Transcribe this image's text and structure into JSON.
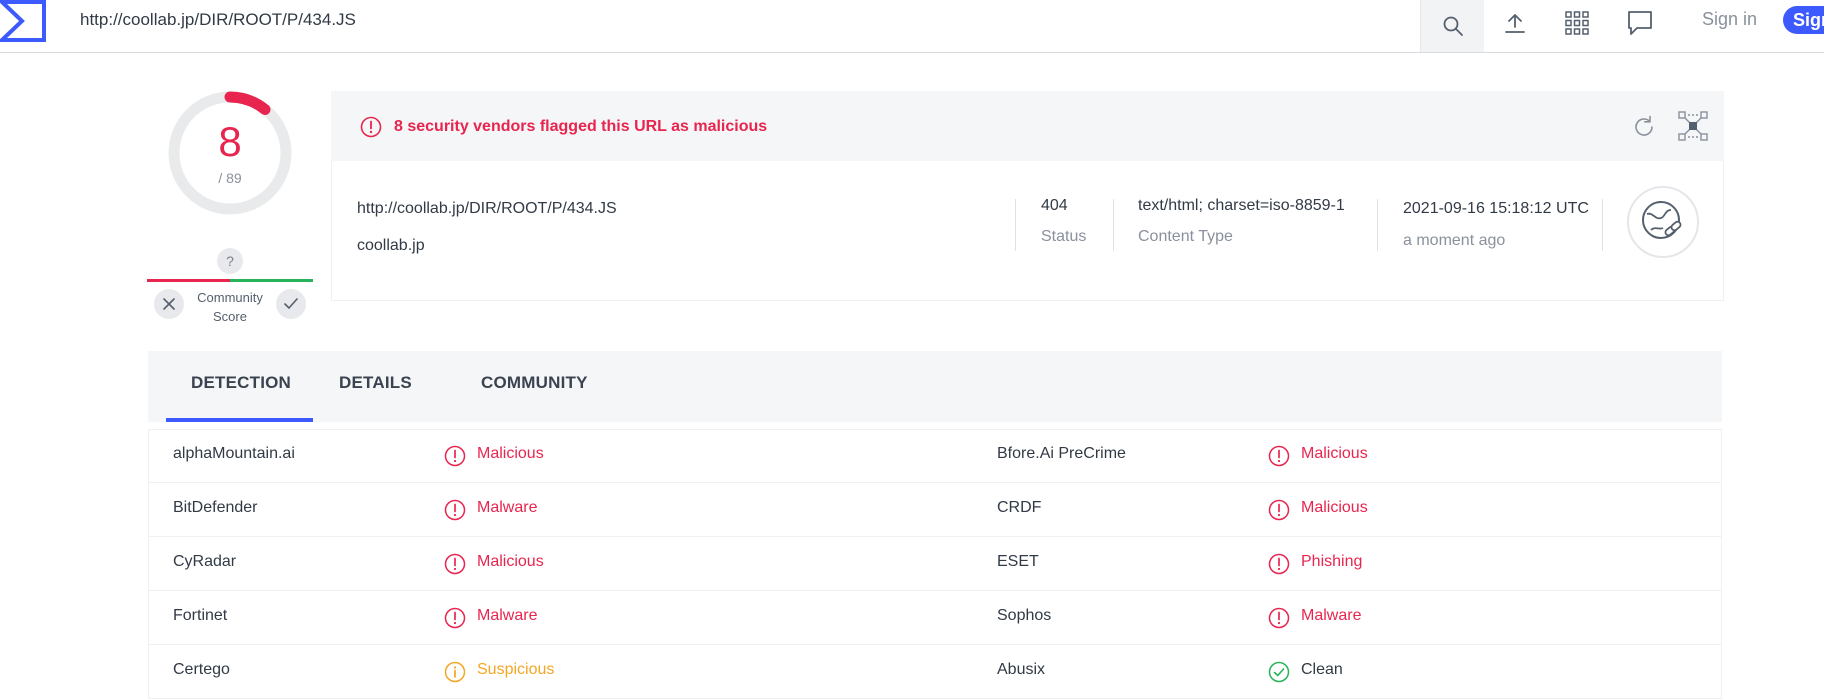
{
  "topbar": {
    "url": "http://coollab.jp/DIR/ROOT/P/434.JS",
    "signin_label": "Sign in",
    "signup_label": "Sign",
    "icons": [
      "search-icon",
      "upload-icon",
      "apps-grid-icon",
      "chat-icon"
    ]
  },
  "score": {
    "detections": "8",
    "total": "/ 89",
    "community_unknown": "?",
    "community_label_1": "Community",
    "community_label_2": "Score"
  },
  "summary": {
    "alert": "8 security vendors flagged this URL as malicious",
    "url": "http://coollab.jp/DIR/ROOT/P/434.JS",
    "domain": "coollab.jp",
    "status_value": "404",
    "status_label": "Status",
    "content_type_value": "text/html; charset=iso-8859-1",
    "content_type_label": "Content Type",
    "date_value": "2021-09-16 15:18:12 UTC",
    "date_label": "a moment ago"
  },
  "tabs": [
    "DETECTION",
    "DETAILS",
    "COMMUNITY"
  ],
  "detections": [
    {
      "vendor": "alphaMountain.ai",
      "verdict": "Malicious",
      "kind": "malicious",
      "vendor2": "Bfore.Ai PreCrime",
      "verdict2": "Malicious",
      "kind2": "malicious"
    },
    {
      "vendor": "BitDefender",
      "verdict": "Malware",
      "kind": "malicious",
      "vendor2": "CRDF",
      "verdict2": "Malicious",
      "kind2": "malicious"
    },
    {
      "vendor": "CyRadar",
      "verdict": "Malicious",
      "kind": "malicious",
      "vendor2": "ESET",
      "verdict2": "Phishing",
      "kind2": "malicious"
    },
    {
      "vendor": "Fortinet",
      "verdict": "Malware",
      "kind": "malicious",
      "vendor2": "Sophos",
      "verdict2": "Malware",
      "kind2": "malicious"
    },
    {
      "vendor": "Certego",
      "verdict": "Suspicious",
      "kind": "suspicious",
      "vendor2": "Abusix",
      "verdict2": "Clean",
      "kind2": "clean"
    }
  ],
  "colors": {
    "malicious": "#e8254f",
    "suspicious": "#f5a623",
    "clean": "#27b35a",
    "accent": "#3d5afe"
  }
}
